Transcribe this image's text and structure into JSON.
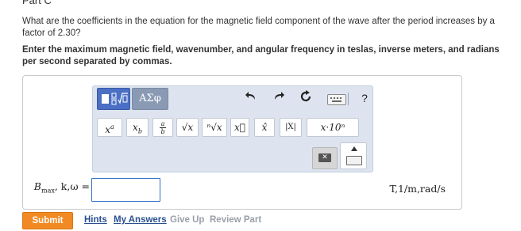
{
  "header": {
    "part_title": "Part C"
  },
  "question": {
    "text": "What are the coefficients in the equation for the magnetic field component of the wave after the period increases by a factor of 2.30?",
    "instruction": "Enter the maximum magnetic field, wavenumber, and angular frequency in teslas, inverse meters, and radians per second separated by commas."
  },
  "palette": {
    "tab_symbols_label": "ΑΣφ",
    "tools": {
      "help_label": "?"
    },
    "buttons": {
      "power": {
        "base": "x",
        "sup": "a"
      },
      "subscript": {
        "base": "x",
        "sub": "b"
      },
      "fraction": {
        "num": "a",
        "den": "b"
      },
      "sqrt": "√x",
      "nthroot": "ⁿ√x",
      "vector": "x⃗",
      "unitvector": "x̂",
      "abs": "|X|",
      "scientific": "x·10ⁿ"
    }
  },
  "answer": {
    "label": {
      "main": "B",
      "sub": "max",
      "rest": ", k,ω ="
    },
    "value": "",
    "units": "T,1/m,rad/s"
  },
  "footer": {
    "submit": "Submit",
    "hints": "Hints",
    "my_answers": "My Answers",
    "give_up": "Give Up",
    "review_part": "Review Part"
  }
}
